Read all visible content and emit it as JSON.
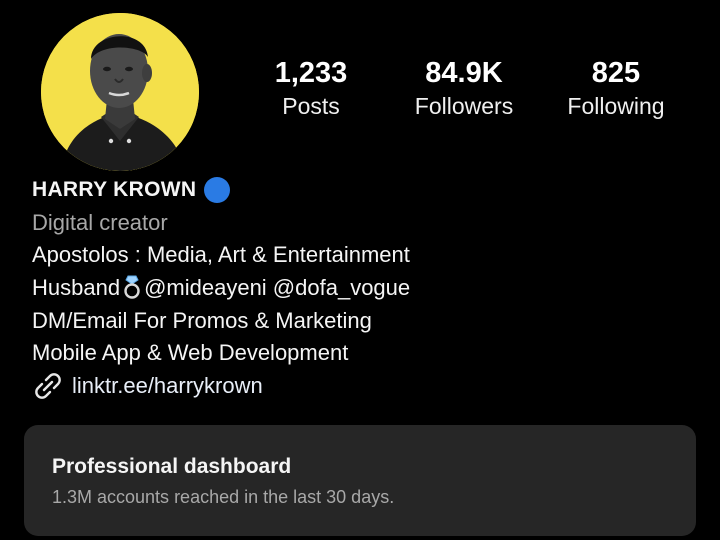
{
  "profile": {
    "name": "HARRY KROWN",
    "category": "Digital creator",
    "avatar_bg": "#f4e04a",
    "verified_color": "#2a7be4"
  },
  "stats": [
    {
      "value": "1,233",
      "label": "Posts"
    },
    {
      "value": "84.9K",
      "label": "Followers"
    },
    {
      "value": "825",
      "label": "Following"
    }
  ],
  "bio": {
    "line1": "Apostolos : Media, Art & Entertainment",
    "line2_prefix": "Husband",
    "line2_emoji": "ring-icon",
    "line2_rest": "@mideayeni @dofa_vogue",
    "line3": "DM/Email For Promos & Marketing",
    "line4": "Mobile App & Web Development",
    "link": "linktr.ee/harrykrown",
    "link_icon": "link-icon"
  },
  "dashboard": {
    "title": "Professional dashboard",
    "subtitle": "1.3M accounts reached in the last 30 days."
  }
}
